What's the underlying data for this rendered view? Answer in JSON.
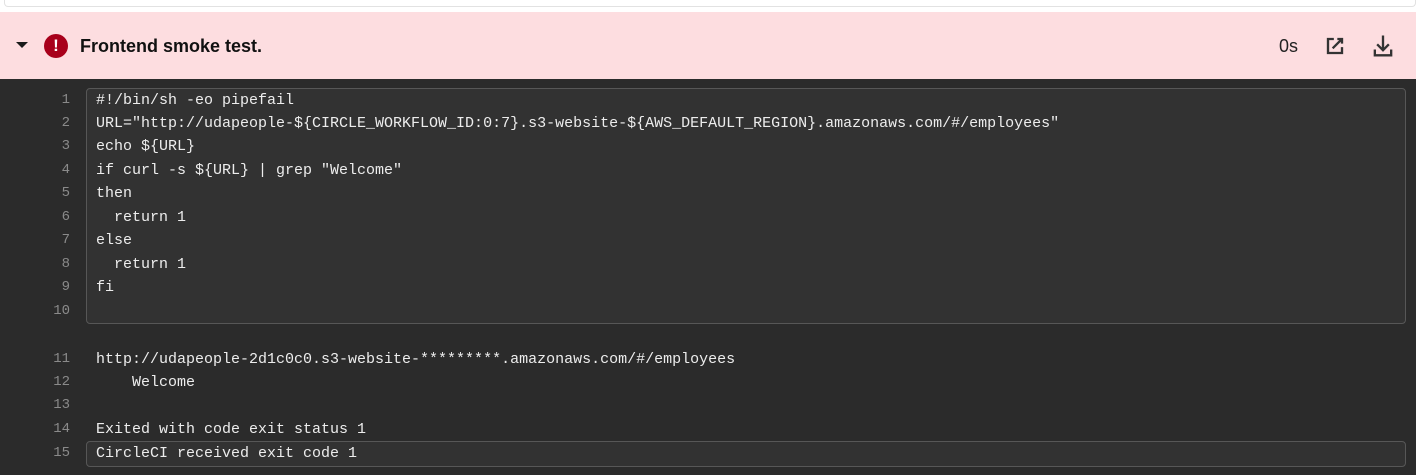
{
  "header": {
    "title": "Frontend smoke test.",
    "duration": "0s",
    "status_color": "#a8001b",
    "background": "#fddde0",
    "icons": {
      "toggle": "chevron-down-icon",
      "status": "error-icon",
      "open": "open-external-icon",
      "download": "download-icon"
    },
    "status_glyph": "!"
  },
  "script_block": {
    "lines": [
      {
        "n": "1",
        "text": "#!/bin/sh -eo pipefail"
      },
      {
        "n": "2",
        "text": "URL=\"http://udapeople-${CIRCLE_WORKFLOW_ID:0:7}.s3-website-${AWS_DEFAULT_REGION}.amazonaws.com/#/employees\""
      },
      {
        "n": "3",
        "text": "echo ${URL}"
      },
      {
        "n": "4",
        "text": "if curl -s ${URL} | grep \"Welcome\""
      },
      {
        "n": "5",
        "text": "then"
      },
      {
        "n": "6",
        "text": "  return 1"
      },
      {
        "n": "7",
        "text": "else"
      },
      {
        "n": "8",
        "text": "  return 1"
      },
      {
        "n": "9",
        "text": "fi"
      },
      {
        "n": "10",
        "text": ""
      }
    ]
  },
  "output": {
    "lines": [
      {
        "n": "11",
        "text": "http://udapeople-2d1c0c0.s3-website-*********.amazonaws.com/#/employees"
      },
      {
        "n": "12",
        "text": "    Welcome"
      },
      {
        "n": "13",
        "text": ""
      },
      {
        "n": "14",
        "text": "Exited with code exit status 1"
      }
    ]
  },
  "exit_block": {
    "n": "15",
    "text": "CircleCI received exit code 1"
  }
}
